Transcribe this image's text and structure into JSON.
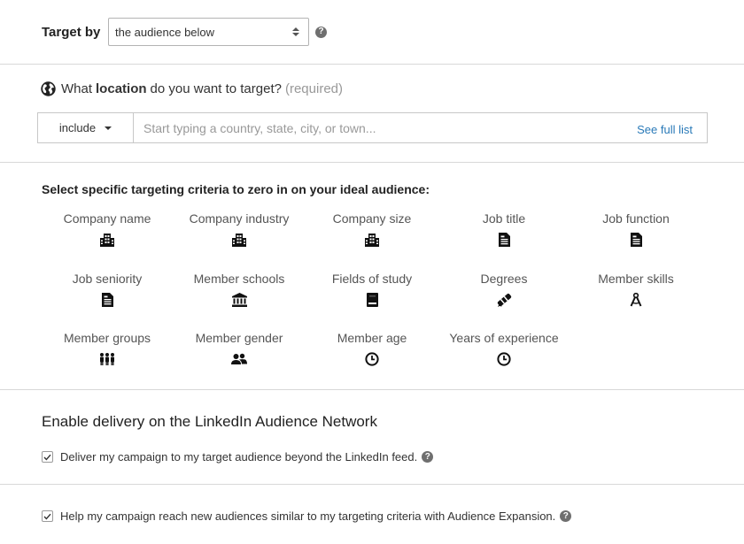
{
  "target": {
    "label": "Target by",
    "selected": "the audience below",
    "help": "?"
  },
  "location": {
    "question_prefix": "What",
    "question_bold": "location",
    "question_suffix": "do you want to target?",
    "required": "(required)",
    "include_label": "include",
    "placeholder": "Start typing a country, state, city, or town...",
    "see_full_list": "See full list"
  },
  "criteria": {
    "heading": "Select specific targeting criteria to zero in on your ideal audience:",
    "items": [
      {
        "label": "Company name",
        "icon": "building-icon"
      },
      {
        "label": "Company industry",
        "icon": "building-icon"
      },
      {
        "label": "Company size",
        "icon": "building-icon"
      },
      {
        "label": "Job title",
        "icon": "document-icon"
      },
      {
        "label": "Job function",
        "icon": "document-icon"
      },
      {
        "label": "Job seniority",
        "icon": "document-icon"
      },
      {
        "label": "Member schools",
        "icon": "institution-icon"
      },
      {
        "label": "Fields of study",
        "icon": "book-icon"
      },
      {
        "label": "Degrees",
        "icon": "diploma-icon"
      },
      {
        "label": "Member skills",
        "icon": "compass-icon"
      },
      {
        "label": "Member groups",
        "icon": "group-icon"
      },
      {
        "label": "Member gender",
        "icon": "people-icon"
      },
      {
        "label": "Member age",
        "icon": "clock-icon"
      },
      {
        "label": "Years of experience",
        "icon": "clock-icon"
      }
    ]
  },
  "audience_network": {
    "heading": "Enable delivery on the LinkedIn Audience Network",
    "deliver_label": "Deliver my campaign to my target audience beyond the LinkedIn feed.",
    "deliver_checked": true
  },
  "expansion": {
    "label": "Help my campaign reach new audiences similar to my targeting criteria with Audience Expansion.",
    "checked": true
  }
}
